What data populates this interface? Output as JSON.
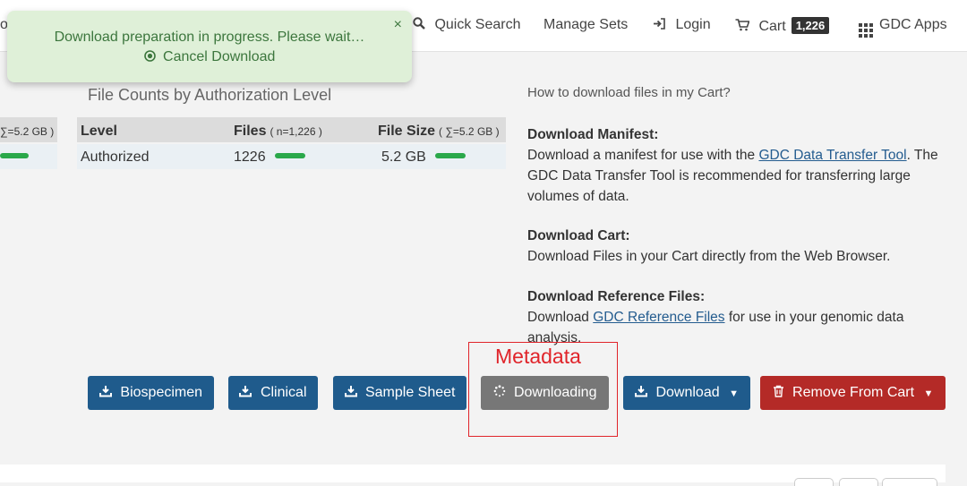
{
  "nav": {
    "cut_text": "o",
    "quick_search": "Quick Search",
    "manage_sets": "Manage Sets",
    "login": "Login",
    "cart": "Cart",
    "cart_count": "1,226",
    "gdc_apps": "GDC Apps"
  },
  "toast": {
    "message": "Download preparation in progress. Please wait…",
    "cancel": "Cancel Download",
    "close": "×"
  },
  "left_partial": {
    "size_sub": "∑=5.2 GB )"
  },
  "auth_table": {
    "title": "File Counts by Authorization Level",
    "headers": {
      "level": "Level",
      "files": "Files",
      "files_sub": "( n=1,226 )",
      "size": "File Size",
      "size_sub": "( ∑=5.2 GB )"
    },
    "rows": [
      {
        "level": "Authorized",
        "files": "1226",
        "size": "5.2 GB"
      }
    ]
  },
  "help": {
    "title": "How to download files in my Cart?",
    "manifest_heading": "Download Manifest:",
    "manifest_text_1": "Download a manifest for use with the ",
    "manifest_link": "GDC Data Transfer Tool",
    "manifest_text_2": ". The GDC Data Transfer Tool is recommended for transferring large volumes of data.",
    "cart_heading": "Download Cart:",
    "cart_text": "Download Files in your Cart directly from the Web Browser.",
    "ref_heading": "Download Reference Files:",
    "ref_text_1": "Download ",
    "ref_link": "GDC Reference Files",
    "ref_text_2": " for use in your genomic data analysis."
  },
  "buttons": {
    "biospecimen": "Biospecimen",
    "clinical": "Clinical",
    "sample_sheet": "Sample Sheet",
    "downloading": "Downloading",
    "download": "Download",
    "remove": "Remove From Cart"
  },
  "annotation": {
    "label": "Metadata"
  },
  "colors": {
    "primary": "#1f5b8c",
    "danger": "#b42a27",
    "success_bar": "#2aa84a",
    "toast_bg": "#dff0d8",
    "annotation": "#e0242a"
  }
}
